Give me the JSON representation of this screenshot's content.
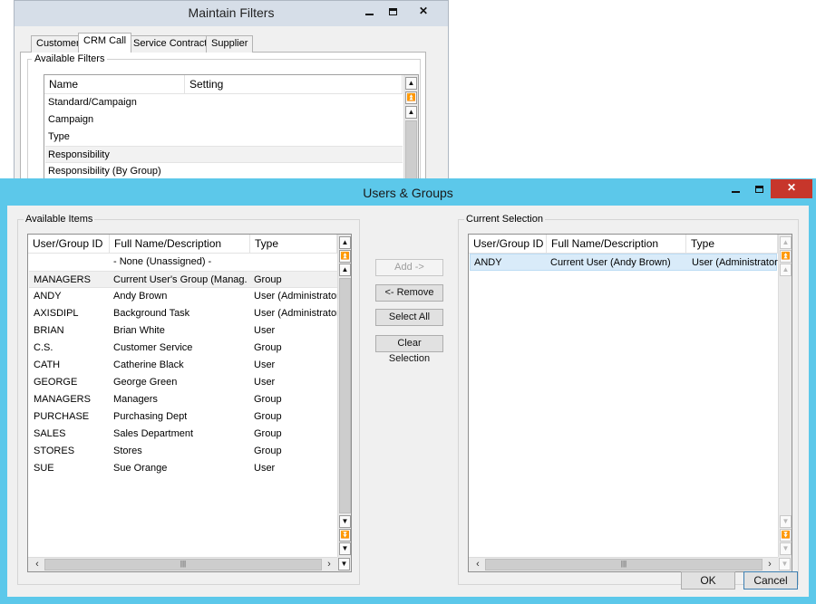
{
  "filters_window": {
    "title": "Maintain Filters",
    "tabs": [
      "Customer",
      "CRM Call",
      "Service Contract",
      "Supplier"
    ],
    "active_tab": "CRM Call",
    "group_label": "Available Filters",
    "columns": [
      "Name",
      "Setting"
    ],
    "rows": [
      {
        "name": "Standard/Campaign",
        "setting": ""
      },
      {
        "name": "Campaign",
        "setting": ""
      },
      {
        "name": "Type",
        "setting": ""
      },
      {
        "name": "Responsibility",
        "setting": ""
      },
      {
        "name": "Responsibility (By Group)",
        "setting": ""
      }
    ]
  },
  "dialog": {
    "title": "Users & Groups",
    "title_bar_color": "#5cc8ea",
    "close_button_color": "#c7362b",
    "available": {
      "label": "Available Items",
      "columns": [
        "User/Group ID",
        "Full Name/Description",
        "Type"
      ],
      "rows": [
        {
          "id": "",
          "name": "- None (Unassigned) -",
          "type": ""
        },
        {
          "id": "MANAGERS",
          "name": "Current User's Group (Manag...",
          "type": "Group"
        },
        {
          "id": "ANDY",
          "name": "Andy Brown",
          "type": "User (Administrator)"
        },
        {
          "id": "AXISDIPL",
          "name": "Background Task",
          "type": "User (Administrator)"
        },
        {
          "id": "BRIAN",
          "name": "Brian White",
          "type": "User"
        },
        {
          "id": "C.S.",
          "name": "Customer Service",
          "type": "Group"
        },
        {
          "id": "CATH",
          "name": "Catherine Black",
          "type": "User"
        },
        {
          "id": "GEORGE",
          "name": "George Green",
          "type": "User"
        },
        {
          "id": "MANAGERS",
          "name": "Managers",
          "type": "Group"
        },
        {
          "id": "PURCHASE",
          "name": "Purchasing Dept",
          "type": "Group"
        },
        {
          "id": "SALES",
          "name": "Sales Department",
          "type": "Group"
        },
        {
          "id": "STORES",
          "name": "Stores",
          "type": "Group"
        },
        {
          "id": "SUE",
          "name": "Sue Orange",
          "type": "User"
        }
      ]
    },
    "buttons": {
      "add": "Add ->",
      "remove": "<- Remove",
      "select_all": "Select All",
      "clear_selection": "Clear Selection",
      "ok": "OK",
      "cancel": "Cancel"
    },
    "current": {
      "label": "Current Selection",
      "columns": [
        "User/Group ID",
        "Full Name/Description",
        "Type"
      ],
      "rows": [
        {
          "id": "ANDY",
          "name": "Current User (Andy Brown)",
          "type": "User (Administrator)"
        }
      ]
    }
  }
}
